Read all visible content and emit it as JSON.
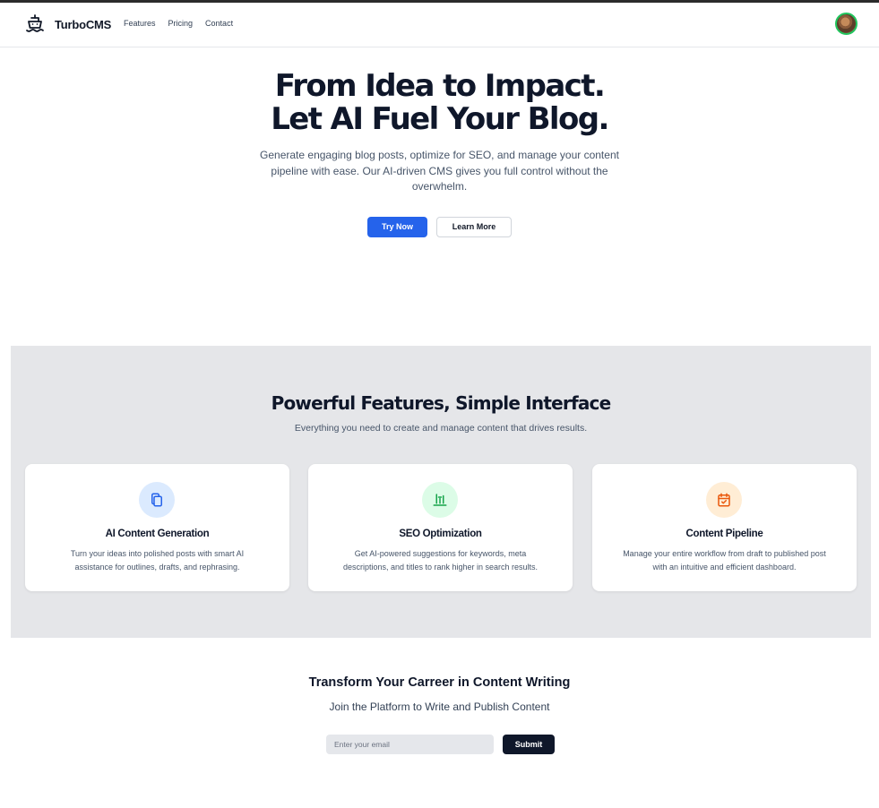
{
  "brand": {
    "name": "TurboCMS",
    "logo_icon": "ship-icon"
  },
  "nav": {
    "items": [
      "Features",
      "Pricing",
      "Contact"
    ]
  },
  "user": {
    "avatar": "cat-avatar"
  },
  "hero": {
    "title_line1": "From Idea to Impact.",
    "title_line2": "Let AI Fuel Your Blog.",
    "description": "Generate engaging blog posts, optimize for SEO, and manage your content pipeline with ease. Our AI-driven CMS gives you full control without the overwhelm.",
    "primary_button": "Try Now",
    "secondary_button": "Learn More"
  },
  "features": {
    "title": "Powerful Features, Simple Interface",
    "subtitle": "Everything you need to create and manage content that drives results.",
    "cards": [
      {
        "title": "AI Content Generation",
        "description": "Turn your ideas into polished posts with smart AI assistance for outlines, drafts, and rephrasing.",
        "icon": "document-copy-icon",
        "icon_color": "#2563eb",
        "icon_bg": "#dbeafe"
      },
      {
        "title": "SEO Optimization",
        "description": "Get AI-powered suggestions for keywords, meta descriptions, and titles to rank higher in search results.",
        "icon": "chart-bars-icon",
        "icon_color": "#16a34a",
        "icon_bg": "#dcfce7"
      },
      {
        "title": "Content Pipeline",
        "description": "Manage your entire workflow from draft to published post with an intuitive and efficient dashboard.",
        "icon": "calendar-check-icon",
        "icon_color": "#ea580c",
        "icon_bg": "#ffedd5"
      }
    ]
  },
  "cta": {
    "title": "Transform Your Carreer in Content Writing",
    "lead": "Join the Platform to Write and Publish Content",
    "email_placeholder": "Enter your email",
    "submit_label": "Submit"
  },
  "colors": {
    "primary": "#2563eb",
    "dark": "#0f172a",
    "section_bg": "#e5e6e9"
  }
}
